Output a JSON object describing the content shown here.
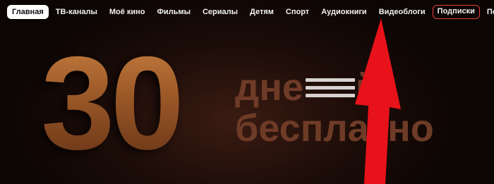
{
  "nav": {
    "items": [
      {
        "label": "Главная",
        "state": "active"
      },
      {
        "label": "ТВ-каналы",
        "state": "normal"
      },
      {
        "label": "Моё кино",
        "state": "normal"
      },
      {
        "label": "Фильмы",
        "state": "normal"
      },
      {
        "label": "Сериалы",
        "state": "normal"
      },
      {
        "label": "Детям",
        "state": "normal"
      },
      {
        "label": "Спорт",
        "state": "normal"
      },
      {
        "label": "Аудиокниги",
        "state": "normal"
      },
      {
        "label": "Видеоблоги",
        "state": "normal"
      },
      {
        "label": "Подписки",
        "state": "highlighted"
      },
      {
        "label": "Подборки",
        "state": "normal"
      }
    ],
    "more_label": "•••",
    "more_icon": "more-dots-icon"
  },
  "hero": {
    "number": "30",
    "line1": "дне",
    "line1_end": "й",
    "line2": "бесплатно"
  },
  "annotation": {
    "arrow_color": "#e8121a",
    "highlight_color": "#e8443a",
    "arrow_icon": "red-pointer-arrow-icon"
  }
}
